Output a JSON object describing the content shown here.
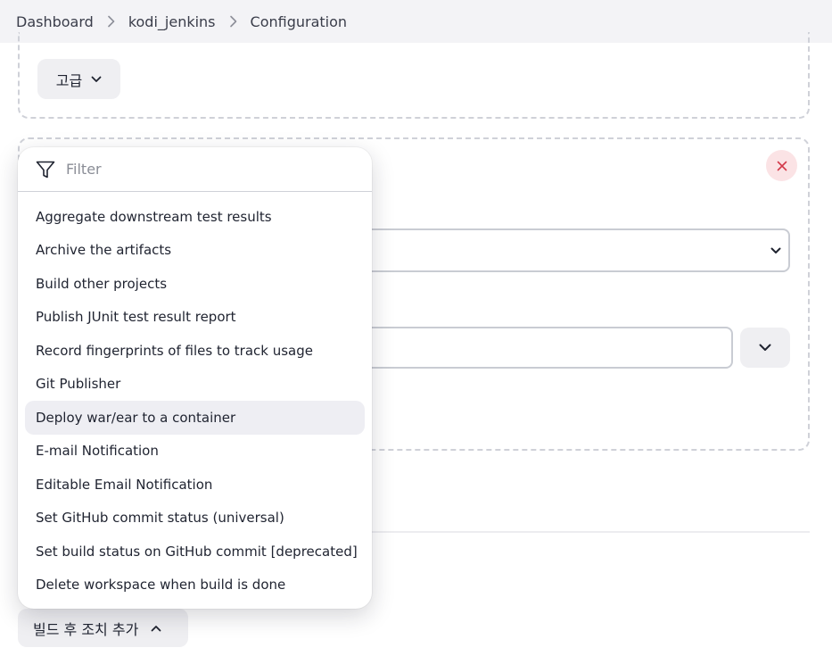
{
  "breadcrumb": {
    "items": [
      "Dashboard",
      "kodi_jenkins",
      "Configuration"
    ],
    "separator_icon": "chevron-right-icon"
  },
  "advanced_button": {
    "label": "고급",
    "icon": "chevron-down-icon"
  },
  "close_button": {
    "icon": "close-icon",
    "color": "#d33a4a"
  },
  "filter": {
    "placeholder": "Filter",
    "value": "",
    "icon": "filter-icon"
  },
  "menu": {
    "items": [
      "Aggregate downstream test results",
      "Archive the artifacts",
      "Build other projects",
      "Publish JUnit test result report",
      "Record fingerprints of files to track usage",
      "Git Publisher",
      "Deploy war/ear to a container",
      "E-mail Notification",
      "Editable Email Notification",
      "Set GitHub commit status (universal)",
      "Set build status on GitHub commit [deprecated]",
      "Delete workspace when build is done"
    ],
    "highlighted": "Deploy war/ear to a container"
  },
  "post_build_button": {
    "label": "빌드 후 조치 추가",
    "icon": "chevron-up-icon"
  },
  "colors": {
    "breadcrumb_bg": "#f3f3f6",
    "hover_bg": "#eeeef3",
    "close_bg": "#fbe3e5"
  }
}
